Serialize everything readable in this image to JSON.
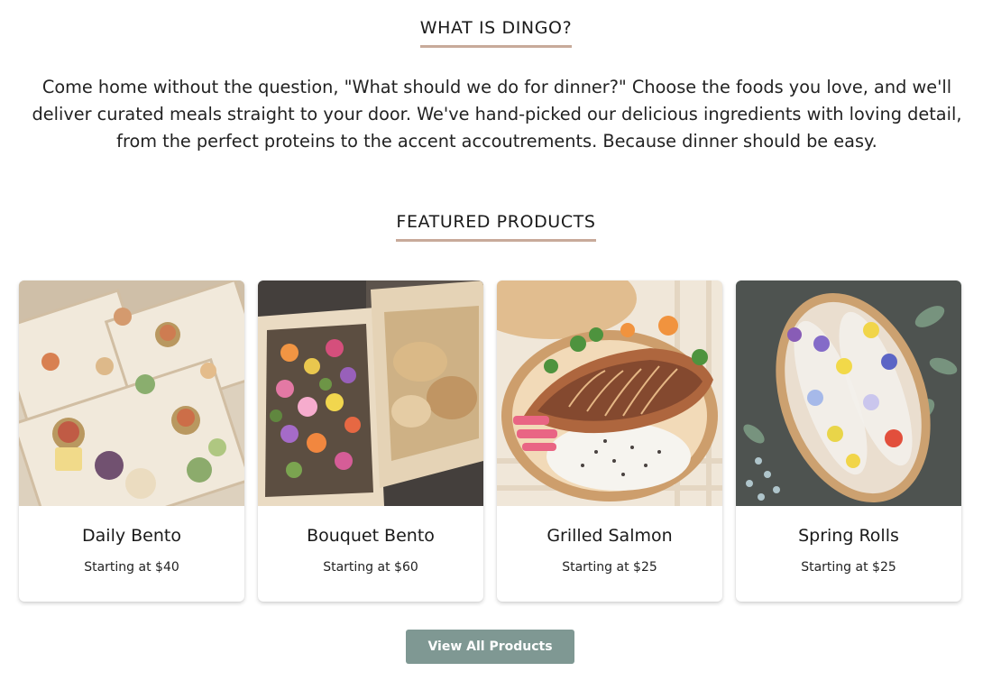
{
  "about": {
    "heading": "WHAT IS DINGO?",
    "body": "Come home without the question, \"What should we do for dinner?\" Choose the foods you love, and we'll deliver curated meals straight to your door. We've hand-picked our delicious ingredients with loving detail, from the perfect proteins to the accent accoutrements. Because dinner should be easy."
  },
  "featured": {
    "heading": "FEATURED PRODUCTS",
    "products": [
      {
        "title": "Daily Bento",
        "price": "Starting at $40"
      },
      {
        "title": "Bouquet Bento",
        "price": "Starting at $60"
      },
      {
        "title": "Grilled Salmon",
        "price": "Starting at $25"
      },
      {
        "title": "Spring Rolls",
        "price": "Starting at $25"
      }
    ],
    "cta_label": "View All Products"
  },
  "colors": {
    "heading_underline": "#c8aa9a",
    "button_bg": "#7f9893",
    "button_text": "#ffffff"
  }
}
